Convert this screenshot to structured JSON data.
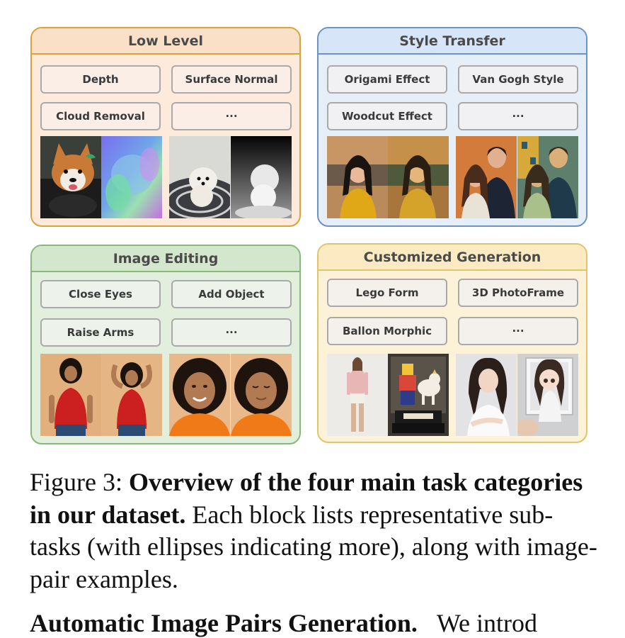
{
  "panels": [
    {
      "title": "Low Level",
      "chips": [
        "Depth",
        "Surface Normal",
        "Cloud Removal",
        "···"
      ]
    },
    {
      "title": "Style Transfer",
      "chips": [
        "Origami Effect",
        "Van Gogh Style",
        "Woodcut Effect",
        "···"
      ]
    },
    {
      "title": "Image Editing",
      "chips": [
        "Close Eyes",
        "Add Object",
        "Raise Arms",
        "···"
      ]
    },
    {
      "title": "Customized Generation",
      "chips": [
        "Lego Form",
        "3D PhotoFrame",
        "Ballon Morphic",
        "···"
      ]
    }
  ],
  "caption": {
    "label": "Figure 3: ",
    "bold": "Overview of the four main task categories in our dataset.",
    "text": " Each block lists representative sub-tasks (with ellipses indicating more), along with image-pair examples."
  },
  "next_heading": {
    "bold": "Automatic Image Pairs Generation.",
    "text": "We introd"
  },
  "colors": {
    "low_level": "#dba13a",
    "style_transfer": "#6d93c4",
    "image_editing": "#86b97a",
    "customized_generation": "#e1c46b"
  }
}
